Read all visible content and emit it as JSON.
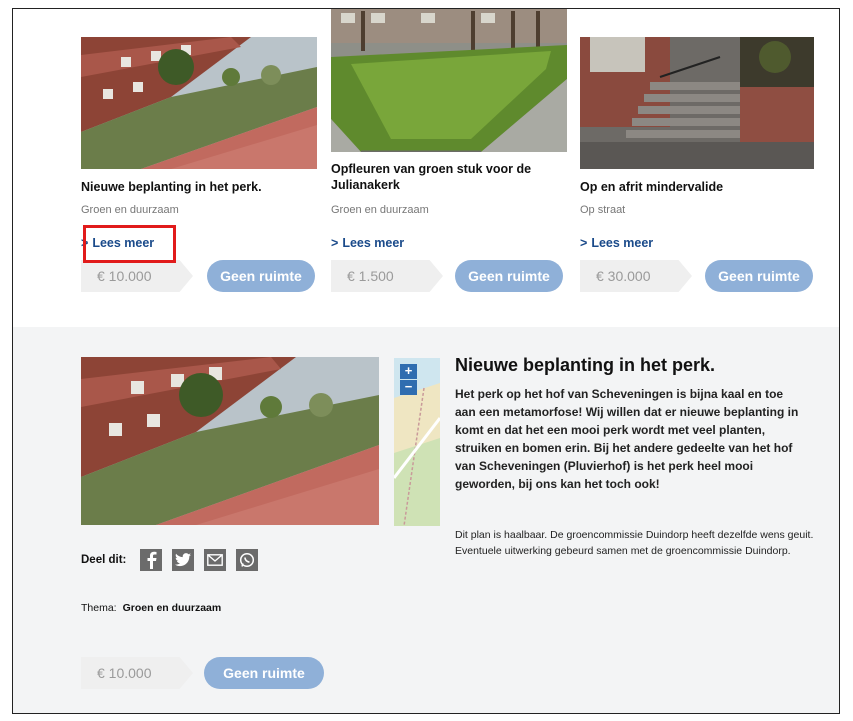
{
  "cards": [
    {
      "title": "Nieuwe beplanting in het perk.",
      "category": "Groen en duurzaam",
      "lees_meer": "Lees meer",
      "amount": "€ 10.000",
      "button": "Geen ruimte"
    },
    {
      "title": "Opfleuren van groen stuk voor de Julianakerk",
      "category": "Groen en duurzaam",
      "lees_meer": "Lees meer",
      "amount": "€ 1.500",
      "button": "Geen ruimte"
    },
    {
      "title": "Op en afrit mindervalide",
      "category": "Op straat",
      "lees_meer": "Lees meer",
      "amount": "€ 30.000",
      "button": "Geen ruimte"
    }
  ],
  "detail": {
    "title": "Nieuwe beplanting in het perk.",
    "body": "Het perk op het hof van Scheveningen is bijna kaal en toe aan een metamorfose! Wij willen dat er nieuwe beplanting in komt en dat het een mooi perk wordt met veel planten, struiken en bomen erin. Bij het andere gedeelte van het hof van Scheveningen (Pluvierhof) is het perk heel mooi geworden, bij ons kan het toch ook!",
    "note": "Dit plan is haalbaar. De groencommissie Duindorp heeft dezelfde wens geuit. Eventuele uitwerking gebeurd samen met de groencommissie Duindorp.",
    "share_label": "Deel dit:",
    "share_icons": [
      "facebook-icon",
      "twitter-icon",
      "email-icon",
      "whatsapp-icon"
    ],
    "theme_label": "Thema:",
    "theme_value": "Groen en duurzaam",
    "amount": "€ 10.000",
    "button": "Geen ruimte",
    "map_zoom_in": "+",
    "map_zoom_out": "−"
  },
  "colors": {
    "button": "#8fb0d8",
    "link": "#1a4a8a",
    "highlight": "#e11b1b",
    "panel": "#f3f4f5"
  }
}
